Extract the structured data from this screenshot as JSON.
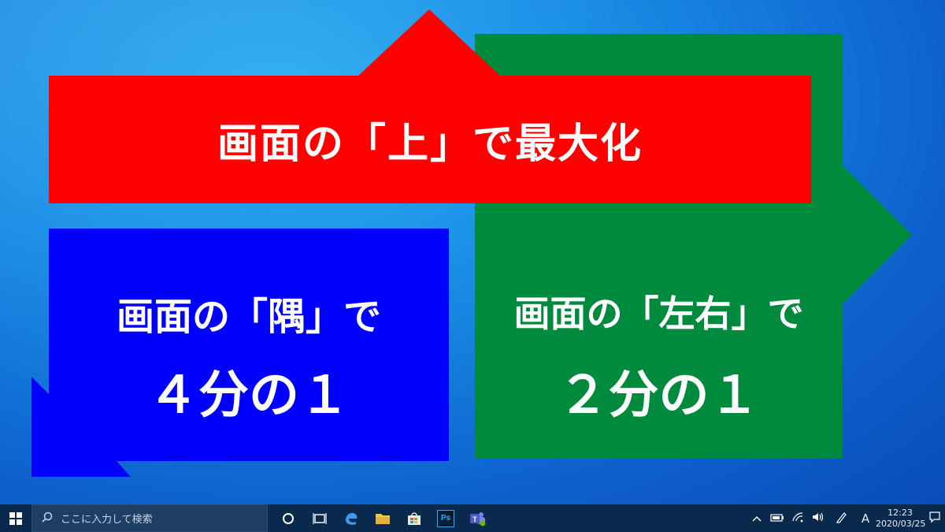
{
  "slides": {
    "red_label": "画面の「上」で最大化",
    "blue_line1": "画面の「隅」で",
    "blue_line2": "４分の１",
    "green_line1": "画面の「左右」で",
    "green_line2": "２分の１"
  },
  "colors": {
    "red": "#ff0000",
    "green": "#008a3e",
    "blue": "#0000ff",
    "taskbar": "#0a2a4d"
  },
  "taskbar": {
    "search_placeholder": "ここに入力して検索",
    "ime_indicator": "A",
    "clock_time": "12:23",
    "clock_date": "2020/03/25",
    "apps": [
      "cortana-icon",
      "task-view-icon",
      "edge-icon",
      "file-explorer-icon",
      "store-icon",
      "photoshop-icon",
      "teams-icon"
    ],
    "photoshop_label": "Ps"
  }
}
